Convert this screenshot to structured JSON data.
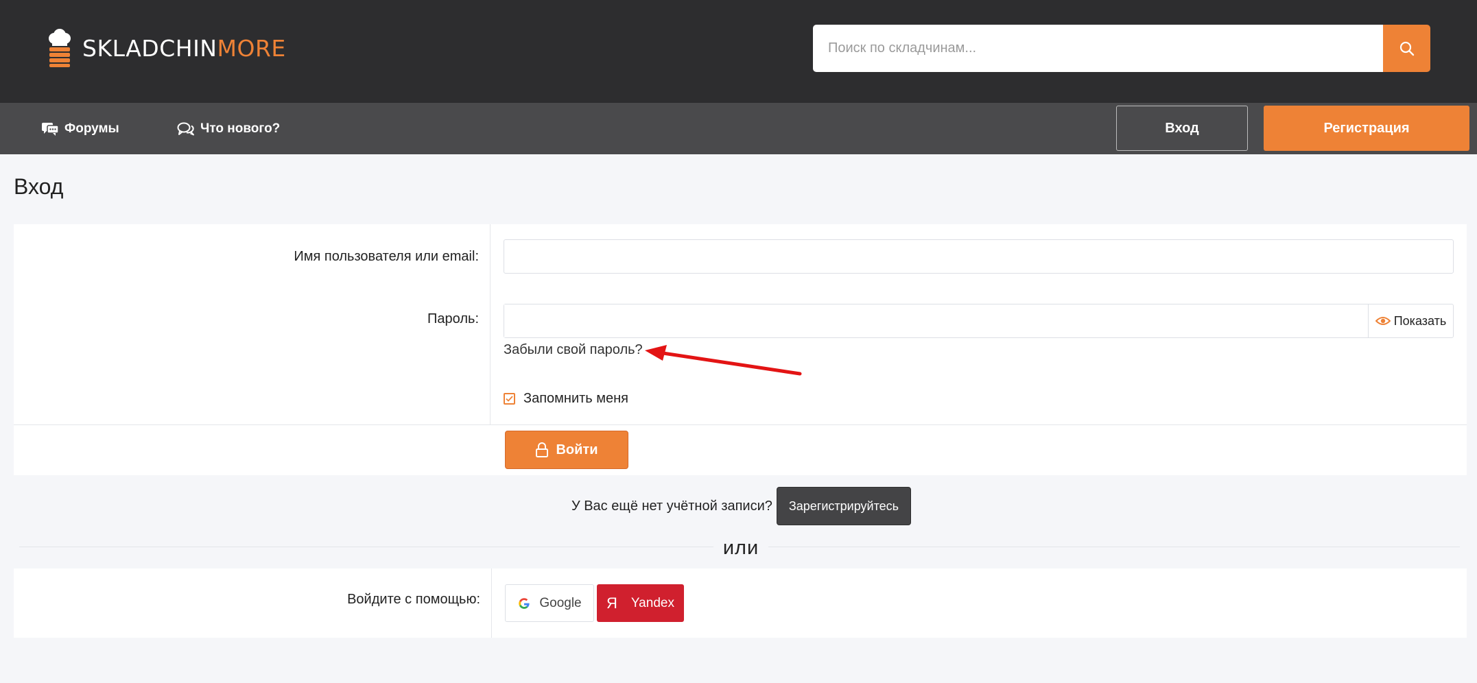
{
  "brand": {
    "name_part1": "SKLADCHIN",
    "name_part2": "MORE",
    "accent_color": "#ee8236",
    "icon": "chef-hat-stack-icon"
  },
  "search": {
    "placeholder": "Поиск по складчинам...",
    "button_icon": "search-icon"
  },
  "nav": {
    "items": [
      {
        "label": "Форумы",
        "icon": "forum-chat-icon"
      },
      {
        "label": "Что нового?",
        "icon": "comments-icon"
      }
    ],
    "login_label": "Вход",
    "register_label": "Регистрация"
  },
  "page": {
    "title": "Вход"
  },
  "form": {
    "username_label": "Имя пользователя или email:",
    "username_value": "",
    "password_label": "Пароль:",
    "password_value": "",
    "show_label": "Показать",
    "forgot_label": "Забыли свой пароль?",
    "remember_label": "Запомнить меня",
    "remember_checked": true,
    "submit_label": "Войти"
  },
  "signup": {
    "text": "У Вас ещё нет учётной записи?",
    "button_label": "Зарегистрируйтесь"
  },
  "divider": {
    "text": "или"
  },
  "social": {
    "label": "Войдите с помощью:",
    "google_label": "Google",
    "yandex_label": "Yandex",
    "yandex_glyph": "Я"
  }
}
